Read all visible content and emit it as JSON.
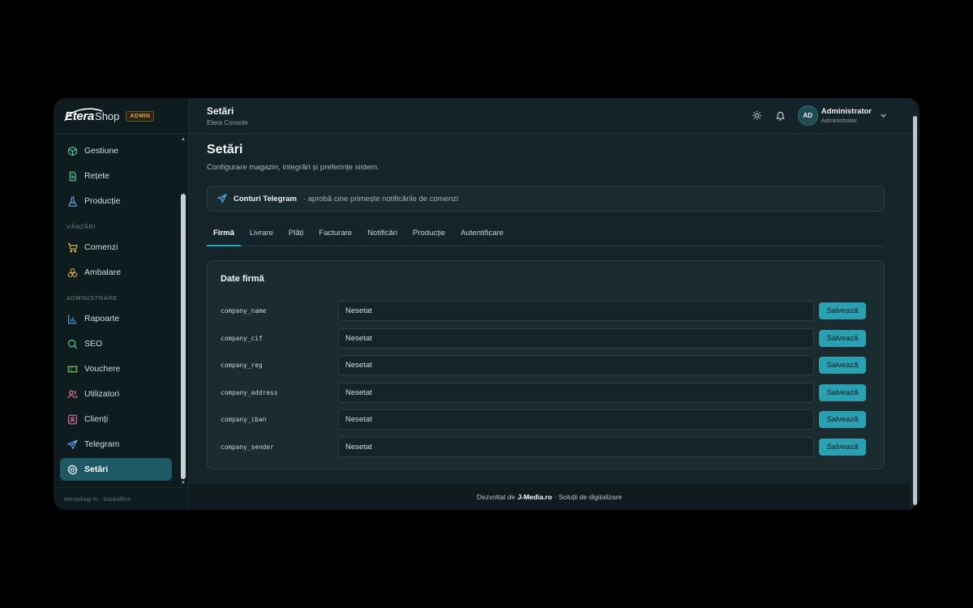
{
  "brand": {
    "logo_main": "Etera",
    "logo_sub": "Shop",
    "badge": "ADMIN"
  },
  "sidebar": {
    "items_top": [
      {
        "label": "Gestiune",
        "icon": "cube-icon"
      },
      {
        "label": "Rețete",
        "icon": "document-icon"
      },
      {
        "label": "Producție",
        "icon": "flask-icon"
      }
    ],
    "section_sales": "VÂNZĂRI",
    "items_sales": [
      {
        "label": "Comenzi",
        "icon": "cart-icon"
      },
      {
        "label": "Ambalare",
        "icon": "packages-icon"
      }
    ],
    "section_admin": "ADMINISTRARE",
    "items_admin": [
      {
        "label": "Rapoarte",
        "icon": "bar-chart-icon"
      },
      {
        "label": "SEO",
        "icon": "search-icon"
      },
      {
        "label": "Vouchere",
        "icon": "ticket-icon"
      },
      {
        "label": "Utilizatori",
        "icon": "users-icon"
      },
      {
        "label": "Clienți",
        "icon": "contact-icon"
      },
      {
        "label": "Telegram",
        "icon": "send-icon"
      },
      {
        "label": "Setări",
        "icon": "gear-icon",
        "active": true
      }
    ],
    "footer": "eterashop.ro · backoffice"
  },
  "topbar": {
    "title": "Setări",
    "subtitle": "Etera Console",
    "avatar_initials": "AD",
    "user_name": "Administrator",
    "user_role": "Administrator"
  },
  "page": {
    "title": "Setări",
    "description": "Configurare magazin, integrări și preferințe sistem."
  },
  "telegram_banner": {
    "title": "Conturi Telegram",
    "text": "· aprobă cine primește notificările de comenzi"
  },
  "tabs": [
    "Firmă",
    "Livrare",
    "Plăți",
    "Facturare",
    "Notificări",
    "Producție",
    "Autentificare"
  ],
  "active_tab": "Firmă",
  "card": {
    "title": "Date firmă",
    "rows": [
      {
        "key": "company_name",
        "placeholder": "Nesetat",
        "button": "Salvează"
      },
      {
        "key": "company_cif",
        "placeholder": "Nesetat",
        "button": "Salvează"
      },
      {
        "key": "company_reg",
        "placeholder": "Nesetat",
        "button": "Salvează"
      },
      {
        "key": "company_address",
        "placeholder": "Nesetat",
        "button": "Salvează"
      },
      {
        "key": "company_iban",
        "placeholder": "Nesetat",
        "button": "Salvează"
      },
      {
        "key": "company_sender",
        "placeholder": "Nesetat",
        "button": "Salvează"
      }
    ]
  },
  "footer": {
    "prefix": "Dezvoltat de",
    "company": "J-Media.ro",
    "suffix": "· Soluții de digitalizare"
  },
  "colors": {
    "accent": "#2aa0b1",
    "active_nav": "#1d5a66",
    "background": "#15242a",
    "sidebar": "#0e1c20"
  }
}
